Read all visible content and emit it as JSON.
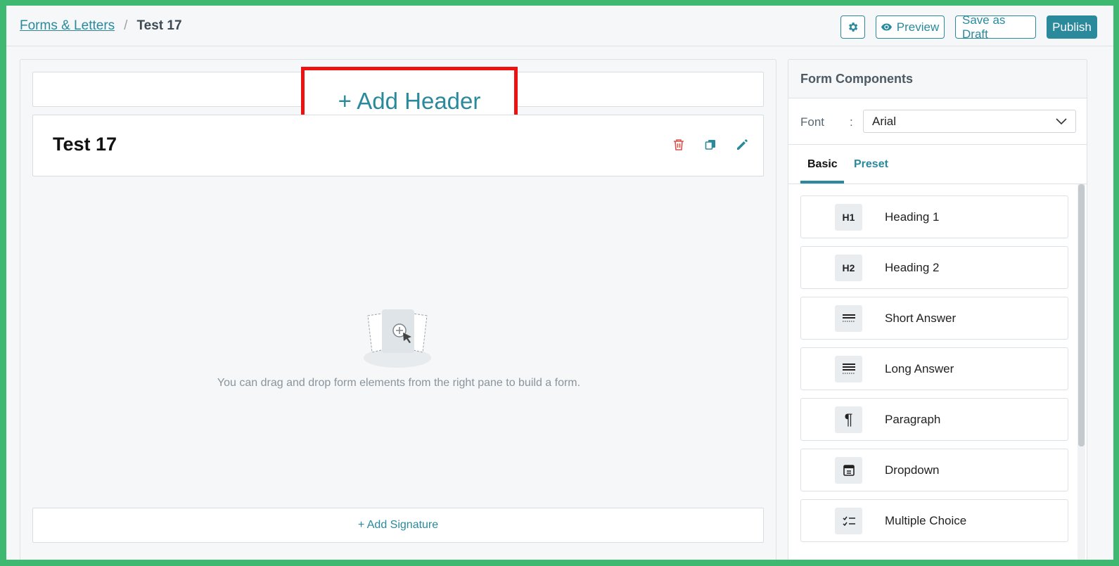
{
  "breadcrumb": {
    "parent": "Forms & Letters",
    "separator": "/",
    "current": "Test 17"
  },
  "toolbar": {
    "settings_icon": "gear-icon",
    "preview_label": "Preview",
    "draft_label": "Save as Draft",
    "publish_label": "Publish"
  },
  "canvas": {
    "add_header_label": "+ Add Header",
    "form_title": "Test 17",
    "empty_message": "You can drag and drop form elements from the right pane to build a form.",
    "add_signature_label": "+ Add Signature"
  },
  "panel": {
    "title": "Form Components",
    "font_label": "Font",
    "font_colon": ":",
    "font_value": "Arial",
    "tabs": [
      "Basic",
      "Preset"
    ],
    "components": [
      {
        "icon_text": "H1",
        "label": "Heading 1"
      },
      {
        "icon_text": "H2",
        "label": "Heading 2"
      },
      {
        "icon_text": "",
        "label": "Short Answer"
      },
      {
        "icon_text": "",
        "label": "Long Answer"
      },
      {
        "icon_text": "¶",
        "label": "Paragraph"
      },
      {
        "icon_text": "",
        "label": "Dropdown"
      },
      {
        "icon_text": "",
        "label": "Multiple Choice"
      }
    ]
  },
  "colors": {
    "accent": "#2a8a9c",
    "highlight": "#ee1111",
    "frame": "#3fb871",
    "delete": "#d9534f"
  }
}
